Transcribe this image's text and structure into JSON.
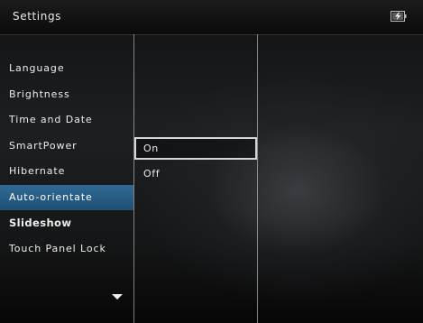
{
  "header": {
    "title": "Settings",
    "status_icon": "battery-charging-icon"
  },
  "menu": {
    "items": [
      {
        "label": "Language"
      },
      {
        "label": "Brightness"
      },
      {
        "label": "Time and Date"
      },
      {
        "label": "SmartPower"
      },
      {
        "label": "Hibernate"
      },
      {
        "label": "Auto-orientate",
        "selected": true
      },
      {
        "label": "Slideshow"
      },
      {
        "label": "Touch Panel Lock"
      }
    ],
    "scroll_icon": "scroll-down-arrow-icon"
  },
  "options": {
    "items": [
      {
        "label": "On",
        "focused": true
      },
      {
        "label": "Off"
      }
    ]
  },
  "colors": {
    "selection": "#2a5f86",
    "focus_border": "#d6d6d6"
  }
}
